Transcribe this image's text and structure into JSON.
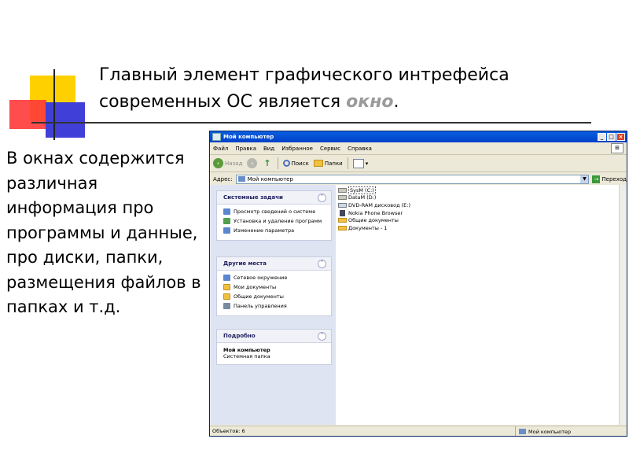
{
  "slide": {
    "title_line1": "Главный элемент графического интрефейса",
    "title_line2_prefix": "современных ОС является ",
    "title_emphasis": "окно",
    "title_suffix": ".",
    "side_text": "В окнах содержится различная информация про программы и данные, про диски, папки, размещения файлов в папках и т.д."
  },
  "window": {
    "title": "Мой компьютер",
    "controls": {
      "minimize": "_",
      "maximize": "□",
      "close": "×"
    },
    "menu": [
      "Файл",
      "Правка",
      "Вид",
      "Избранное",
      "Сервис",
      "Справка"
    ],
    "toolbar": {
      "back": "Назад",
      "search": "Поиск",
      "folders": "Папки"
    },
    "address": {
      "label": "Адрес:",
      "value": "Мой компьютер",
      "go": "Переход"
    },
    "panels": {
      "system_tasks": {
        "title": "Системные задачи",
        "items": [
          "Просмотр сведений о системе",
          "Установка и удаление программ",
          "Изменение параметра"
        ]
      },
      "other_places": {
        "title": "Другие места",
        "items": [
          "Сетевое окружение",
          "Мои документы",
          "Общие документы",
          "Панель управления"
        ]
      },
      "details": {
        "title": "Подробно",
        "name": "Мой компьютер",
        "type": "Системная папка"
      }
    },
    "files": [
      {
        "label": "SysM (C:)",
        "icon": "drive-icon"
      },
      {
        "label": "DataM (D:)",
        "icon": "drive-icon"
      },
      {
        "label": "DVD-RAM дисковод (E:)",
        "icon": "dvd-icon"
      },
      {
        "label": "Nokia Phone Browser",
        "icon": "phone-icon"
      },
      {
        "label": "Общие документы",
        "icon": "folder-icon"
      },
      {
        "label": "Документы - 1",
        "icon": "folder-icon"
      }
    ],
    "status": {
      "objects": "Объектов: 6",
      "location": "Мой компьютер"
    }
  }
}
